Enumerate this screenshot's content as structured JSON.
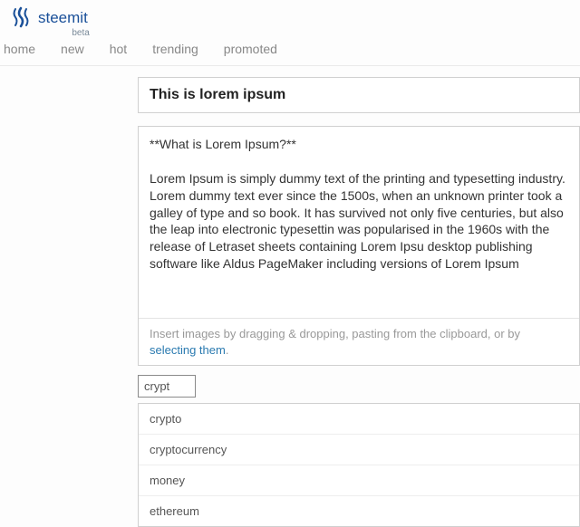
{
  "header": {
    "brand": "steemit",
    "beta": "beta"
  },
  "nav": [
    "home",
    "new",
    "hot",
    "trending",
    "promoted"
  ],
  "editor": {
    "title": "This is lorem ipsum",
    "body_question": "**What is Lorem Ipsum?**",
    "body_text": "Lorem Ipsum is simply dummy text of the printing and typesetting industry. Lorem dummy text ever since the 1500s, when an unknown printer took a galley of type and so book. It has survived not only five centuries, but also the leap into electronic typesettin was popularised in the 1960s with the release of Letraset sheets containing Lorem Ipsu desktop publishing software like Aldus PageMaker including versions of Lorem Ipsum",
    "hint_prefix": "Insert images by dragging & dropping, pasting from the clipboard, or by ",
    "hint_link": "selecting them",
    "hint_suffix": "."
  },
  "tags": {
    "input": "crypt",
    "suggestions": [
      "crypto",
      "cryptocurrency",
      "money",
      "ethereum"
    ]
  }
}
